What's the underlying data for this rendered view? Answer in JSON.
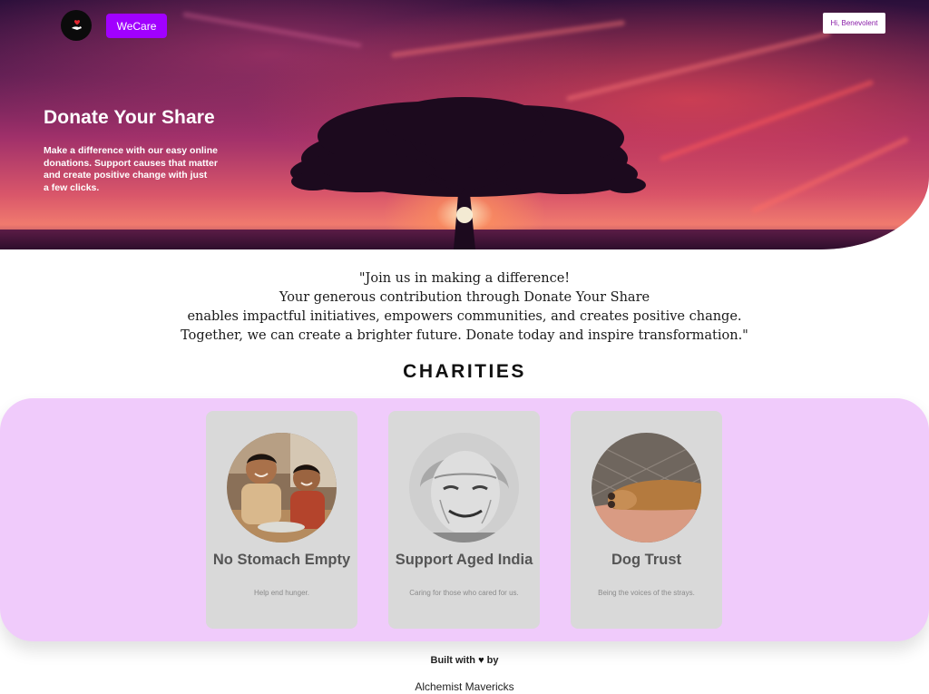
{
  "header": {
    "logo_icon": "hand-heart-logo-icon",
    "brand_label": "WeCare",
    "greeting_label": "Hi, Benevolent"
  },
  "hero": {
    "title": "Donate Your Share",
    "subtitle_lines": [
      "Make a difference with our easy online",
      "donations. Support causes that matter",
      "and create positive change with just",
      "a few clicks."
    ]
  },
  "quote": {
    "lines": [
      "\"Join us in making a difference!",
      "Your generous contribution through Donate Your Share",
      "enables impactful initiatives, empowers communities, and creates positive change.",
      "Together, we can create a brighter future. Donate today and inspire transformation.\""
    ]
  },
  "charities": {
    "heading": "CHARITIES",
    "items": [
      {
        "name": "No Stomach Empty",
        "tagline": "Help end hunger.",
        "image_icon": "children-photo"
      },
      {
        "name": "Support Aged India",
        "tagline": "Caring for those who cared for us.",
        "image_icon": "elderly-woman-photo"
      },
      {
        "name": "Dog Trust",
        "tagline": "Being the voices of the strays.",
        "image_icon": "dog-paw-photo"
      }
    ]
  },
  "footer": {
    "built_prefix": "Built with",
    "heart_icon": "heart-icon",
    "built_suffix": "by",
    "team": "Alchemist Mavericks"
  },
  "colors": {
    "accent": "#a100ff",
    "panel": "#f0cbfb",
    "card": "#d9d9d9"
  }
}
